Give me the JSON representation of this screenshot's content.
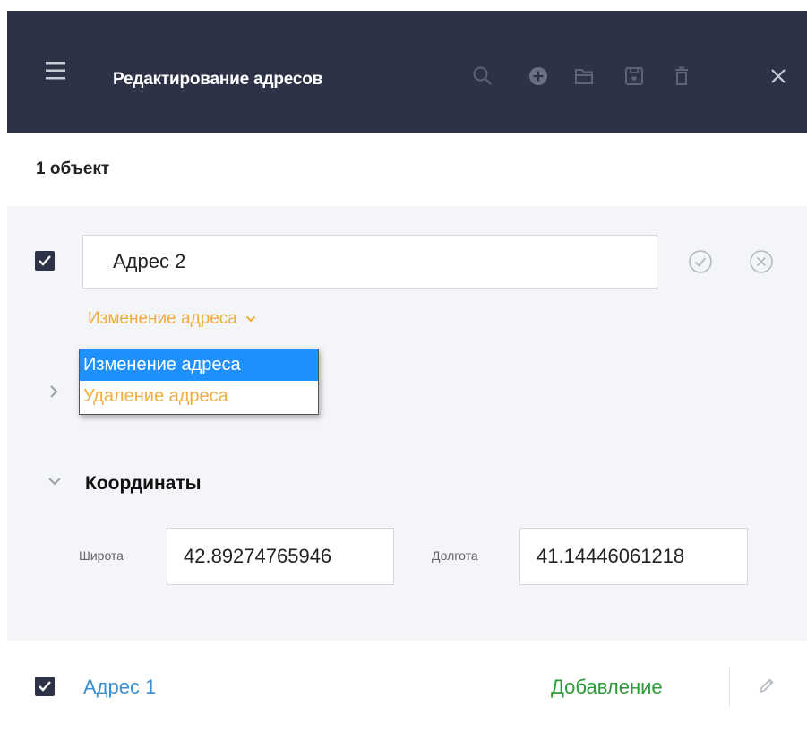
{
  "header": {
    "title": "Редактирование адресов",
    "icons": [
      "menu-icon",
      "search-icon",
      "add-circle-icon",
      "folder-icon",
      "save-icon",
      "delete-icon",
      "close-icon"
    ],
    "bg_color": "#2d3246"
  },
  "object_count": "1 объект",
  "item1": {
    "checked": true,
    "address_value": "Адрес 2",
    "action_selected": "Изменение адреса",
    "action_options": [
      "Изменение адреса",
      "Удаление адреса"
    ],
    "coordinates": {
      "section_title": "Координаты",
      "latitude_label": "Широта",
      "latitude_value": "42.89274765946",
      "longitude_label": "Долгота",
      "longitude_value": "41.14446061218"
    }
  },
  "item2": {
    "checked": true,
    "address_label": "Адрес 1",
    "status": "Добавление"
  },
  "colors": {
    "accent_orange": "#f0ad3f",
    "select_blue": "#1e90ff",
    "link_blue": "#3b8fd1",
    "status_green": "#2e9b3a"
  }
}
